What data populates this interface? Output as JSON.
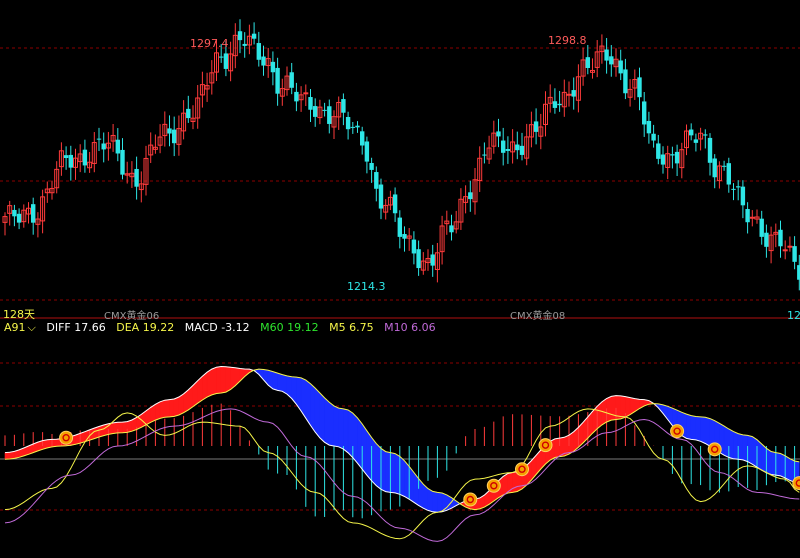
{
  "colors": {
    "background": "#000000",
    "up": "#ff3b3b",
    "down": "#2ee6e6",
    "grid": "#8b0000",
    "axis_text": "#a0a0a0",
    "diff": "#ffffff",
    "dea": "#f5f54a",
    "m60": "#2ee62e",
    "m5": "#f5f54a",
    "m10": "#c06ad8",
    "band_up": "#ff1a1a",
    "band_down": "#1a2eff",
    "marker_fill": "#f5a000",
    "marker_text": "#d00000"
  },
  "price_labels": {
    "high1": "1297.4",
    "high2": "1298.8",
    "low1": "1214.3",
    "right_cut": "12"
  },
  "axis": {
    "period": "128天",
    "contract1": "CMX黄金06",
    "contract2": "CMX黄金08"
  },
  "indicator": {
    "name": "A91",
    "diff_label": "DIFF",
    "diff_value": "17.66",
    "dea_label": "DEA",
    "dea_value": "19.22",
    "macd_label": "MACD",
    "macd_value": "-3.12",
    "m60_label": "M60",
    "m60_value": "19.12",
    "m5_label": "M5",
    "m5_value": "6.75",
    "m10_label": "M10",
    "m10_value": "6.06"
  },
  "chart_data": [
    {
      "type": "candlestick",
      "title": "",
      "y_range": [
        1205,
        1305
      ],
      "highs_labeled": [
        1297.4,
        1298.8
      ],
      "lows_labeled": [
        1214.3
      ],
      "anchors": [
        [
          0,
          1232
        ],
        [
          6,
          1236
        ],
        [
          14,
          1254
        ],
        [
          22,
          1258
        ],
        [
          28,
          1247
        ],
        [
          34,
          1262
        ],
        [
          40,
          1270
        ],
        [
          46,
          1289
        ],
        [
          50,
          1295
        ],
        [
          55,
          1288
        ],
        [
          59,
          1280
        ],
        [
          64,
          1272
        ],
        [
          70,
          1270
        ],
        [
          76,
          1260
        ],
        [
          80,
          1240
        ],
        [
          86,
          1224
        ],
        [
          90,
          1218
        ],
        [
          95,
          1230
        ],
        [
          99,
          1245
        ],
        [
          103,
          1258
        ],
        [
          108,
          1258
        ],
        [
          112,
          1262
        ],
        [
          118,
          1275
        ],
        [
          124,
          1284
        ],
        [
          128,
          1291
        ],
        [
          134,
          1276
        ],
        [
          138,
          1258
        ],
        [
          142,
          1254
        ],
        [
          148,
          1262
        ],
        [
          152,
          1250
        ],
        [
          158,
          1235
        ],
        [
          164,
          1225
        ],
        [
          169,
          1216
        ]
      ]
    },
    {
      "type": "macd",
      "title": "",
      "y_range": [
        -80,
        80
      ],
      "series": [
        {
          "name": "DIFF",
          "anchors": [
            [
              0,
              -5
            ],
            [
              10,
              5
            ],
            [
              25,
              18
            ],
            [
              35,
              35
            ],
            [
              46,
              60
            ],
            [
              52,
              58
            ],
            [
              58,
              42
            ],
            [
              70,
              0
            ],
            [
              82,
              -35
            ],
            [
              92,
              -50
            ],
            [
              100,
              -40
            ],
            [
              108,
              -20
            ],
            [
              118,
              6
            ],
            [
              130,
              38
            ],
            [
              136,
              35
            ],
            [
              146,
              5
            ],
            [
              156,
              -10
            ],
            [
              164,
              -22
            ],
            [
              169,
              -28
            ]
          ]
        },
        {
          "name": "DEA",
          "anchors": [
            [
              0,
              -10
            ],
            [
              12,
              0
            ],
            [
              25,
              10
            ],
            [
              35,
              22
            ],
            [
              46,
              40
            ],
            [
              54,
              58
            ],
            [
              62,
              52
            ],
            [
              72,
              28
            ],
            [
              82,
              -5
            ],
            [
              92,
              -35
            ],
            [
              100,
              -48
            ],
            [
              108,
              -35
            ],
            [
              118,
              -8
            ],
            [
              130,
              20
            ],
            [
              138,
              32
            ],
            [
              148,
              22
            ],
            [
              158,
              8
            ],
            [
              164,
              -5
            ],
            [
              169,
              -12
            ]
          ]
        },
        {
          "name": "M5",
          "anchors": [
            [
              0,
              -48
            ],
            [
              10,
              -32
            ],
            [
              20,
              12
            ],
            [
              26,
              25
            ],
            [
              34,
              8
            ],
            [
              42,
              18
            ],
            [
              50,
              15
            ],
            [
              56,
              -5
            ],
            [
              66,
              -35
            ],
            [
              74,
              -58
            ],
            [
              84,
              -70
            ],
            [
              92,
              -50
            ],
            [
              100,
              -25
            ],
            [
              108,
              -20
            ],
            [
              116,
              15
            ],
            [
              124,
              28
            ],
            [
              132,
              22
            ],
            [
              140,
              -10
            ],
            [
              148,
              -42
            ],
            [
              158,
              -15
            ],
            [
              166,
              -25
            ],
            [
              169,
              -35
            ]
          ]
        },
        {
          "name": "M10",
          "anchors": [
            [
              0,
              -58
            ],
            [
              14,
              -22
            ],
            [
              24,
              0
            ],
            [
              36,
              15
            ],
            [
              48,
              28
            ],
            [
              56,
              18
            ],
            [
              64,
              -8
            ],
            [
              74,
              -38
            ],
            [
              84,
              -62
            ],
            [
              92,
              -72
            ],
            [
              100,
              -52
            ],
            [
              110,
              -30
            ],
            [
              120,
              -5
            ],
            [
              128,
              10
            ],
            [
              136,
              20
            ],
            [
              144,
              5
            ],
            [
              152,
              -20
            ],
            [
              160,
              -35
            ],
            [
              169,
              -40
            ]
          ]
        }
      ],
      "histogram": "DIFF minus DEA",
      "markers": "A91 signal points on DIFF line"
    }
  ]
}
